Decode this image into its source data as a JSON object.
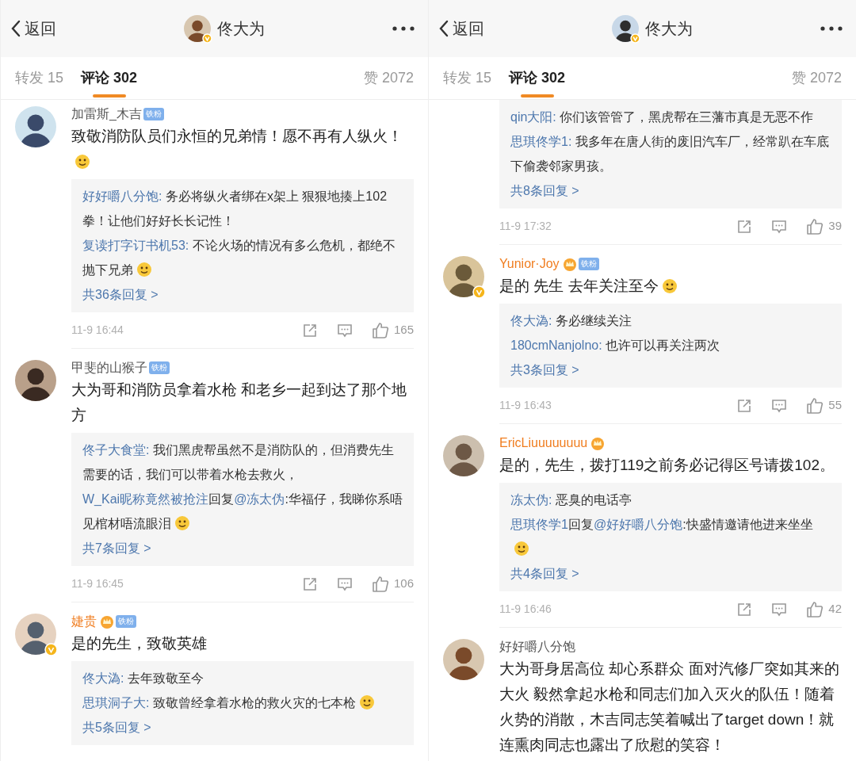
{
  "panels": [
    {
      "header": {
        "back": "返回",
        "title": "佟大为",
        "verified": true
      },
      "tabs": [
        {
          "label": "转发 15",
          "selected": false
        },
        {
          "label": "评论 302",
          "selected": true
        },
        {
          "label": "赞 2072",
          "selected": false
        }
      ],
      "comments": [
        {
          "author": "加雷斯_木吉",
          "member": false,
          "crown": false,
          "badge": "铁粉",
          "verified": false,
          "text": "致敬消防队员们永恒的兄弟情！愿不再有人纵火！",
          "emoji": true,
          "replies": [
            {
              "user": "好好嚼八分饱:",
              "text": " 务必将纵火者绑在x架上 狠狠地揍上102拳！让他们好好长长记性！",
              "emoji": false
            },
            {
              "user": "复读打字订书机53:",
              "text": " 不论火场的情况有多么危机，都绝不抛下兄弟",
              "emoji": true
            }
          ],
          "more": "共36条回复 >",
          "time": "11-9 16:44",
          "likes": "165"
        },
        {
          "author": "甲斐的山猴子",
          "member": false,
          "crown": false,
          "badge": "铁粉",
          "verified": false,
          "text": "大为哥和消防员拿着水枪 和老乡一起到达了那个地方",
          "emoji": false,
          "replies": [
            {
              "user": "佟子大食堂:",
              "text": " 我们黑虎帮虽然不是消防队的，但消费先生需要的话，我们可以带着水枪去救火，",
              "emoji": false
            },
            {
              "user": "W_Kai昵称竟然被抢注",
              "connector": "回复",
              "reply_to": "@冻太伪",
              "text": ":华福仔，我睇你系唔见棺材唔流眼泪",
              "emoji": true
            }
          ],
          "more": "共7条回复 >",
          "time": "11-9 16:45",
          "likes": "106"
        },
        {
          "author": "婕贵",
          "member": true,
          "crown": true,
          "badge": "铁粉",
          "verified": true,
          "text": "是的先生，致敬英雄",
          "emoji": false,
          "replies": [
            {
              "user": "佟大溈:",
              "text": " 去年致敬至今",
              "emoji": false
            },
            {
              "user": "思琪洞子大:",
              "text": " 致敬曾经拿着水枪的救火灾的七本枪",
              "emoji": true
            }
          ],
          "more": "共5条回复 >"
        }
      ]
    },
    {
      "header": {
        "back": "返回",
        "title": "佟大为",
        "verified": true
      },
      "tabs": [
        {
          "label": "转发 15",
          "selected": false
        },
        {
          "label": "评论 302",
          "selected": true
        },
        {
          "label": "赞 2072",
          "selected": false
        }
      ],
      "comments": [
        {
          "replies": [
            {
              "user": "qin大阳:",
              "text": " 你们该管管了，黑虎帮在三藩市真是无恶不作",
              "emoji": false
            },
            {
              "user": "思琪佟学1:",
              "text": " 我多年在唐人街的废旧汽车厂，经常趴在车底下偷袭邻家男孩。",
              "emoji": false
            }
          ],
          "more": "共8条回复 >",
          "time": "11-9 17:32",
          "likes": "39"
        },
        {
          "author": "Yunior·Joy",
          "member": true,
          "crown": true,
          "badge": "铁粉",
          "verified": true,
          "text": "是的 先生 去年关注至今",
          "emoji": true,
          "replies": [
            {
              "user": "佟大溈:",
              "text": " 务必继续关注",
              "emoji": false
            },
            {
              "user": "180cmNanjolno:",
              "text": " 也许可以再关注两次",
              "emoji": false
            }
          ],
          "more": "共3条回复 >",
          "time": "11-9 16:43",
          "likes": "55"
        },
        {
          "author": "EricLiuuuuuuuu",
          "member": true,
          "crown": true,
          "verified": false,
          "text": "是的，先生，拨打119之前务必记得区号请拨102。",
          "emoji": false,
          "replies": [
            {
              "user": "冻太伪:",
              "text": " 恶臭的电话亭",
              "emoji": false
            },
            {
              "user": "思琪佟学1",
              "connector": "回复",
              "reply_to": "@好好嚼八分饱",
              "text": ":快盛情邀请他进来坐坐",
              "emoji": true
            }
          ],
          "more": "共4条回复 >",
          "time": "11-9 16:46",
          "likes": "42"
        },
        {
          "author": "好好嚼八分饱",
          "member": false,
          "crown": false,
          "verified": false,
          "text": "大为哥身居高位 却心系群众 面对汽修厂突如其来的大火 毅然拿起水枪和同志们加入灭火的队伍！随着火势的消散，木吉同志笑着喊出了target down！就连熏肉同志也露出了欣慰的笑容！",
          "emoji": false
        }
      ]
    }
  ]
}
